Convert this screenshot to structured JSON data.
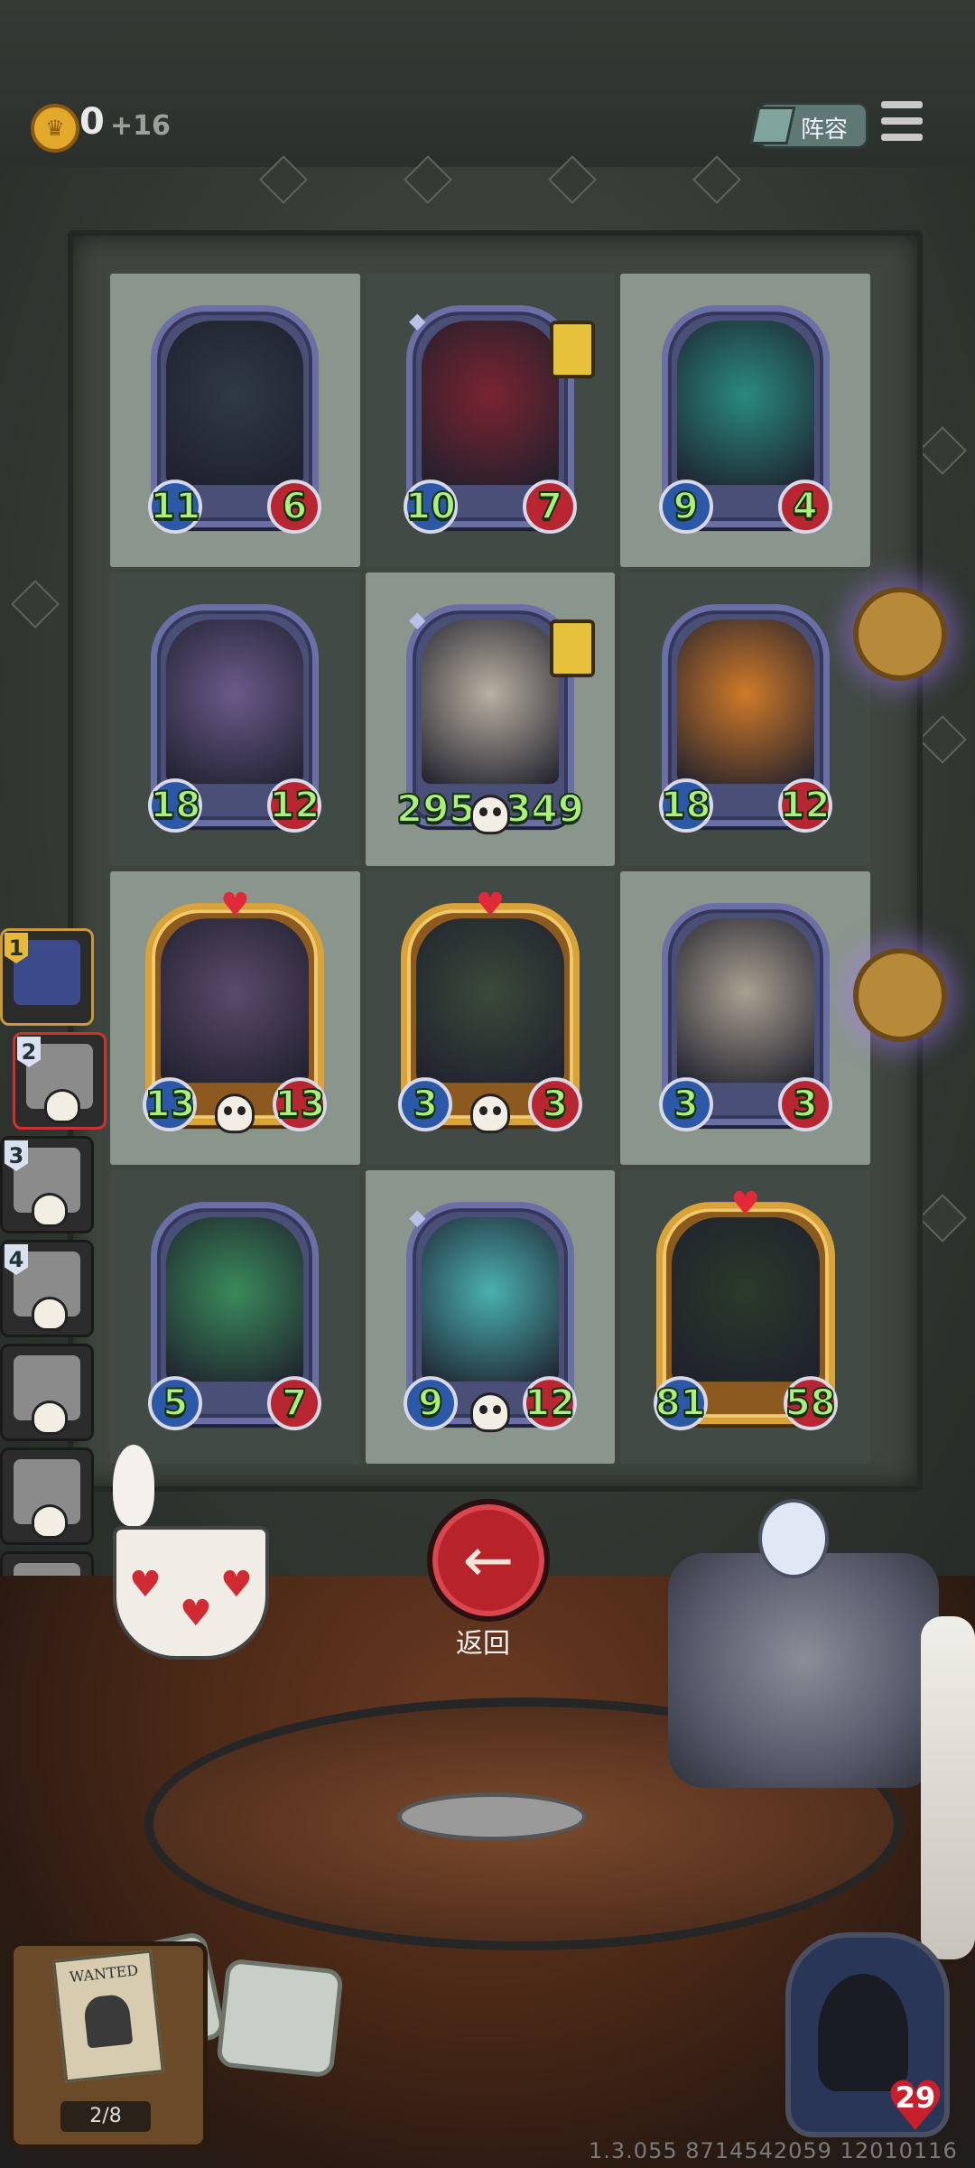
{
  "top_bar": {
    "gold": "0",
    "gold_income": "+16",
    "team_label": "阵容"
  },
  "board": {
    "cells": [
      {
        "atk": "11",
        "hp": "6",
        "frame": "blue",
        "shade": "light",
        "art": "hooded-skull-necromancer"
      },
      {
        "atk": "10",
        "hp": "7",
        "frame": "blue",
        "shade": "dark",
        "art": "jester-clown",
        "lantern": true,
        "gem": true
      },
      {
        "atk": "9",
        "hp": "4",
        "frame": "blue",
        "shade": "light",
        "art": "ghost-spirit"
      },
      {
        "atk": "18",
        "hp": "12",
        "frame": "blue",
        "shade": "dark",
        "art": "purple-dragon"
      },
      {
        "atk": "295",
        "hp": "349",
        "frame": "blue",
        "shade": "light",
        "art": "bone-dragon",
        "lantern": true,
        "gem": true,
        "skull": true
      },
      {
        "atk": "18",
        "hp": "12",
        "frame": "blue",
        "shade": "dark",
        "art": "pumpkin-mummy"
      },
      {
        "atk": "13",
        "hp": "13",
        "frame": "gold",
        "shade": "light",
        "art": "stitched-golem",
        "skull": true
      },
      {
        "atk": "3",
        "hp": "3",
        "frame": "gold",
        "shade": "dark",
        "art": "tentacle-chest",
        "skull": true
      },
      {
        "atk": "3",
        "hp": "3",
        "frame": "blue",
        "shade": "light",
        "art": "old-scribe"
      },
      {
        "atk": "5",
        "hp": "7",
        "frame": "blue",
        "shade": "dark",
        "art": "green-ghosts"
      },
      {
        "atk": "9",
        "hp": "12",
        "frame": "blue",
        "shade": "light",
        "art": "cyan-brute",
        "gem": true,
        "skull": true
      },
      {
        "atk": "81",
        "hp": "58",
        "frame": "gold",
        "shade": "dark",
        "art": "green-fire-beast"
      }
    ]
  },
  "roster": [
    {
      "num": "1",
      "active": true
    },
    {
      "num": "2",
      "selected": true
    },
    {
      "num": "3"
    },
    {
      "num": "4"
    },
    {
      "num": ""
    },
    {
      "num": ""
    },
    {
      "num": ""
    },
    {
      "num": ""
    }
  ],
  "back_label": "返回",
  "wanted": {
    "label": "WANTED",
    "count": "2/8"
  },
  "player": {
    "health": "29"
  },
  "version": "1.3.055 8714542059 12010116",
  "colors": {
    "atk_badge": "#2c58a8",
    "hp_badge": "#b82632",
    "stat_text": "#aaf07a",
    "gold_frame": "#d9a33a",
    "blue_frame": "#6a6fa5"
  }
}
